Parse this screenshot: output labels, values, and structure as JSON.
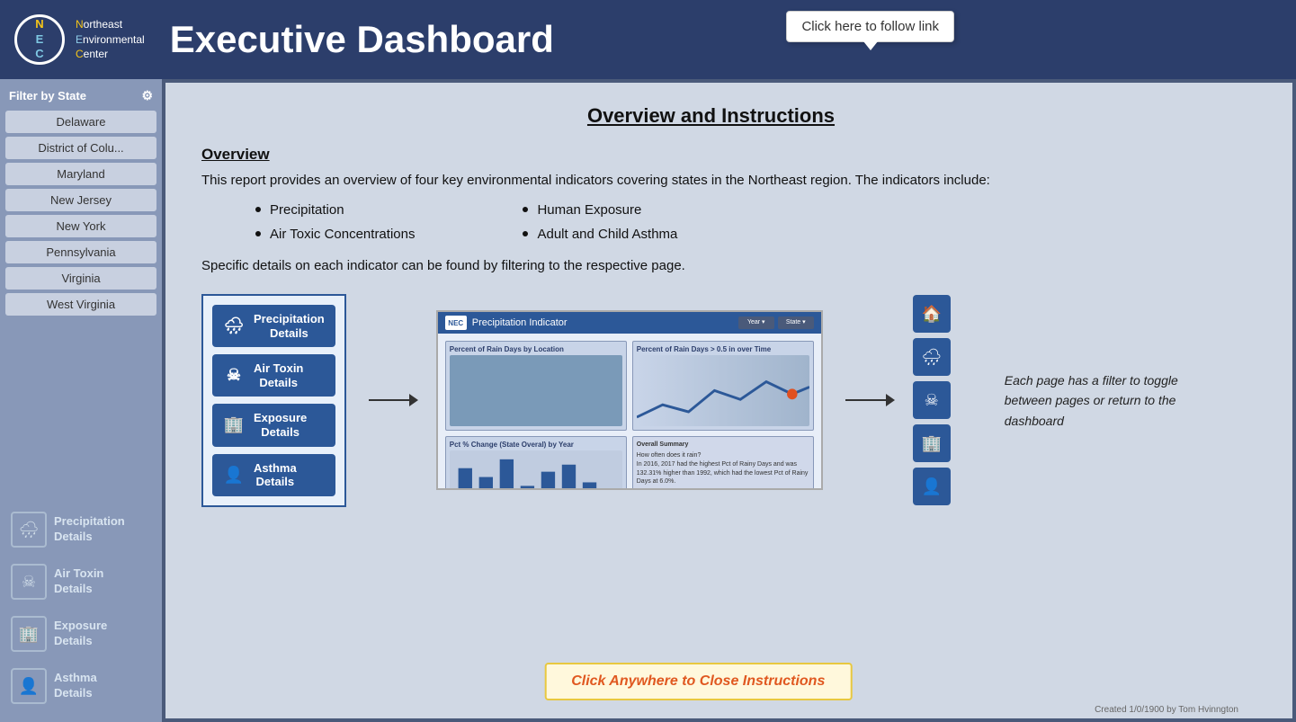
{
  "header": {
    "logo_initials": "NEC",
    "org_line1": "Northeast",
    "org_line2": "Environmental",
    "org_line3": "Center",
    "title": "Executive Dashboard",
    "tooltip": "Click here to follow link"
  },
  "sidebar": {
    "filter_label": "Filter by State",
    "states": [
      "Delaware",
      "District of Colu...",
      "Maryland",
      "New Jersey",
      "New York",
      "Pennsylvania",
      "Virginia",
      "West Virginia"
    ],
    "nav_items": [
      {
        "id": "precipitation",
        "icon": "🌧",
        "label": "Precipitation\nDetails"
      },
      {
        "id": "air-toxin",
        "icon": "☠",
        "label": "Air Toxin\nDetails"
      },
      {
        "id": "exposure",
        "icon": "🏢",
        "label": "Exposure\nDetails"
      },
      {
        "id": "asthma",
        "icon": "👤",
        "label": "Asthma\nDetails"
      }
    ]
  },
  "instructions": {
    "panel_title": "Overview and Instructions",
    "overview_heading": "Overview",
    "overview_text": "This report provides an overview of four key environmental indicators covering states in the Northeast region.  The indicators include:",
    "bullet_col1": [
      "Precipitation",
      "Air Toxic Concentrations"
    ],
    "bullet_col2": [
      "Human Exposure",
      "Adult and Child Asthma"
    ],
    "specific_text": "Specific details on each indicator can be found by filtering to the respective page.",
    "page_buttons": [
      {
        "icon": "🌧",
        "label": "Precipitation\nDetails"
      },
      {
        "icon": "☠",
        "label": "Air Toxin\nDetails"
      },
      {
        "icon": "🏢",
        "label": "Exposure\nDetails"
      },
      {
        "icon": "👤",
        "label": "Asthma\nDetails"
      }
    ],
    "mockup_title": "Precipitation Indicator",
    "side_note": "Each page has a filter to toggle between pages or return to the dashboard",
    "close_text": "Click Anywhere to Close Instructions"
  },
  "right_sidebar": {
    "icons": [
      "🏠",
      "🌧",
      "☠",
      "🏢",
      "👤"
    ]
  },
  "footer": {
    "credit": "Created 1/0/1900 by Tom Hvinngton"
  }
}
